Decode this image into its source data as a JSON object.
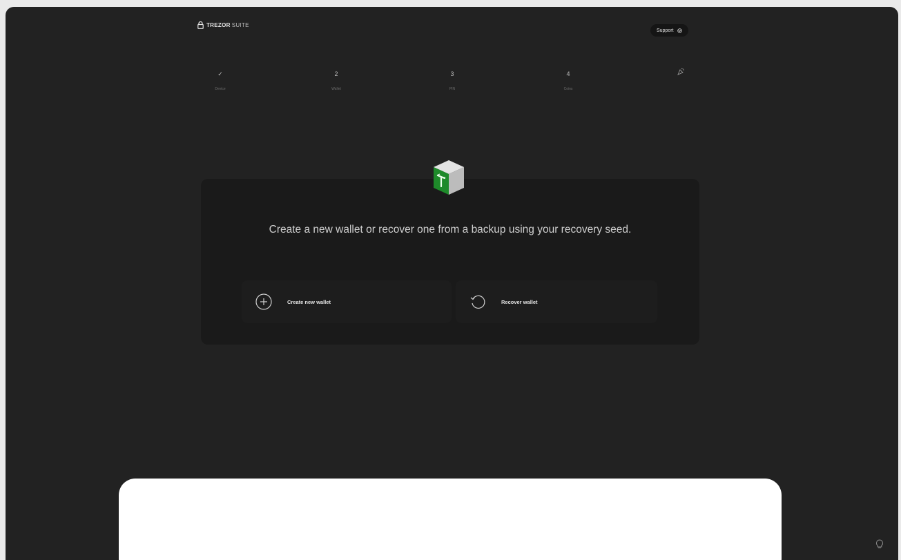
{
  "app": {
    "logo_brand": "TREZOR",
    "logo_suffix": "SUITE",
    "support_label": "Support"
  },
  "steps": [
    {
      "marker": "✓",
      "label": "Device",
      "state": "done"
    },
    {
      "marker": "2",
      "label": "Wallet",
      "state": "active"
    },
    {
      "marker": "3",
      "label": "PIN",
      "state": "pending"
    },
    {
      "marker": "4",
      "label": "Coins",
      "state": "pending"
    },
    {
      "marker": "",
      "label": "",
      "state": "final",
      "icon": "confetti-icon"
    }
  ],
  "main": {
    "headline": "Create a new wallet or recover one from a backup using your recovery seed.",
    "options": [
      {
        "label": "Create new wallet",
        "icon": "plus-circle-icon"
      },
      {
        "label": "Recover wallet",
        "icon": "recover-icon"
      }
    ]
  },
  "colors": {
    "background": "#222222",
    "card": "#1a1a1a",
    "accent_green": "#1e8a2a"
  }
}
